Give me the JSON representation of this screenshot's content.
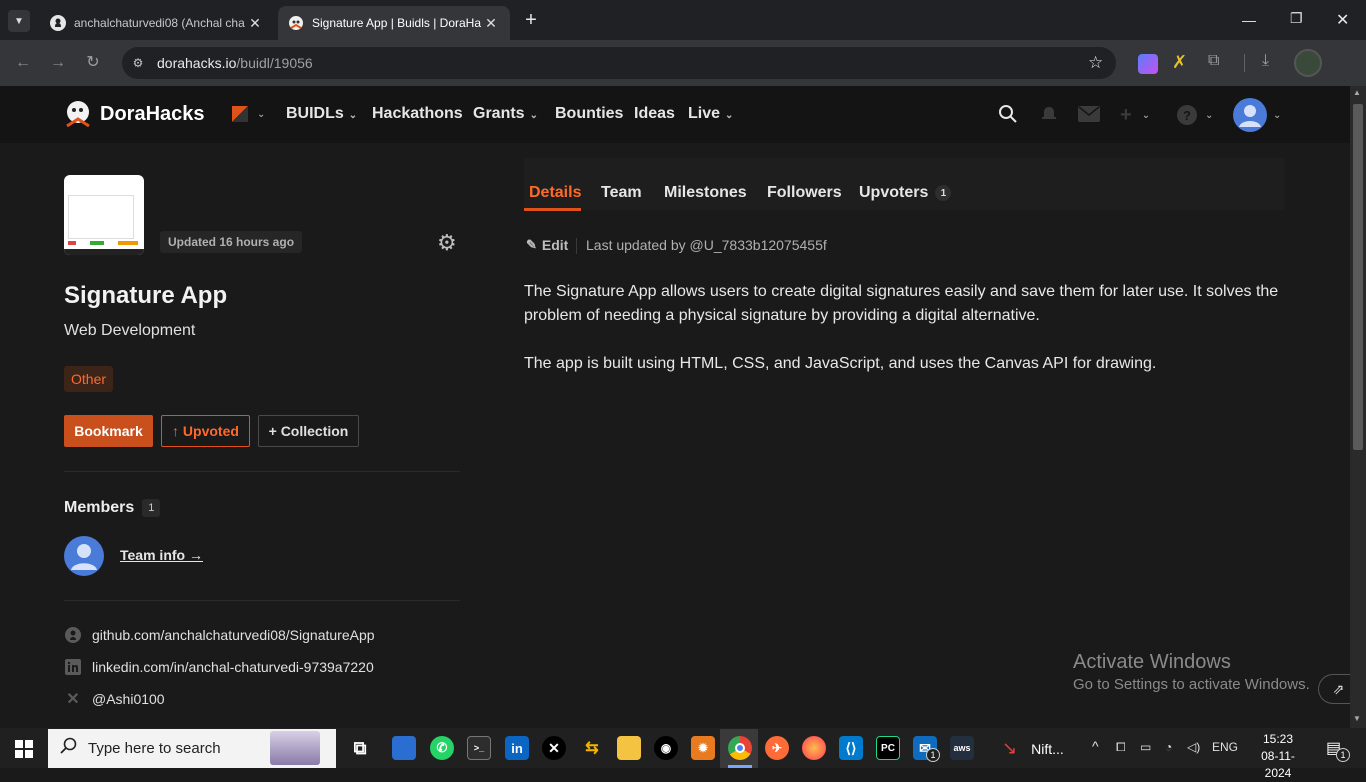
{
  "browser": {
    "tabs": [
      {
        "title": "anchalchaturvedi08 (Anchal cha",
        "active": false
      },
      {
        "title": "Signature App | Buidls | DoraHa",
        "active": true
      }
    ],
    "new_tab": "+",
    "url_domain": "dorahacks.io",
    "url_path": "/buidl/19056"
  },
  "site": {
    "brand": "DoraHacks",
    "nav": [
      "BUIDLs",
      "Hackathons",
      "Grants",
      "Bounties",
      "Ideas",
      "Live"
    ]
  },
  "project": {
    "updated": "Updated 16 hours ago",
    "name": "Signature App",
    "category": "Web Development",
    "tag": "Other",
    "buttons": {
      "bookmark": "Bookmark",
      "upvoted": "↑ Upvoted",
      "collection": "+ Collection"
    },
    "members_label": "Members",
    "members_count": "1",
    "team_info": "Team info →",
    "links": {
      "github": "github.com/anchalchaturvedi08/SignatureApp",
      "linkedin": "linkedin.com/in/anchal-chaturvedi-9739a7220",
      "x": "@Ashi0100"
    }
  },
  "tabs": {
    "items": [
      "Details",
      "Team",
      "Milestones",
      "Followers",
      "Upvoters"
    ],
    "upvoters_count": "1",
    "active": "Details"
  },
  "details": {
    "edit": "Edit",
    "last_updated": "Last updated by @U_7833b12075455f",
    "paragraph1": "The Signature App allows users to create digital signatures easily and save them for later use. It solves the problem of needing a physical signature by providing a digital alternative.",
    "paragraph2": "The app is built using HTML, CSS, and JavaScript, and uses the Canvas API for drawing."
  },
  "watermark": {
    "title": "Activate Windows",
    "subtitle": "Go to Settings to activate Windows."
  },
  "taskbar": {
    "search_placeholder": "Type here to search",
    "nifty_label": "Nift...",
    "lang": "ENG",
    "time": "15:23",
    "date": "08-11-2024",
    "mail_badge": "1",
    "notif_badge": "1"
  },
  "colors": {
    "accent": "#e0521a",
    "accent_text": "#ff6a2b",
    "page_bg": "#1a1a1a",
    "header_bg": "#141414"
  }
}
